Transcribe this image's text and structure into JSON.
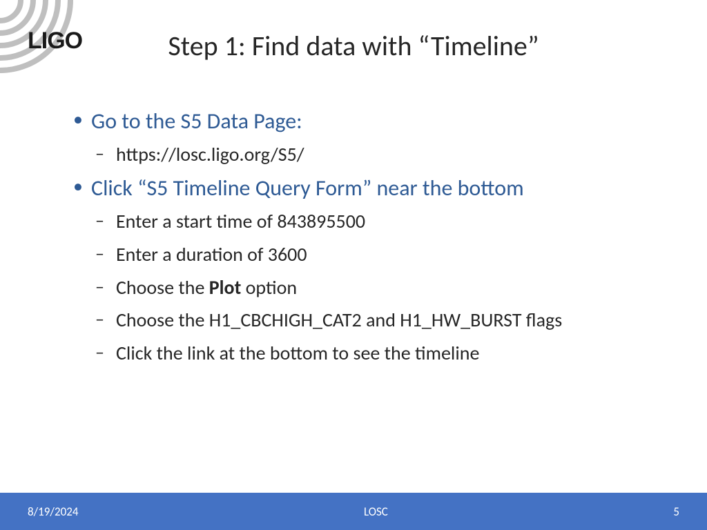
{
  "logo": {
    "text": "LIGO"
  },
  "title": "Step 1: Find data with “Timeline”",
  "bullets": [
    {
      "text": "Go to the S5 Data Page:",
      "children": [
        {
          "text": "https://losc.ligo.org/S5/"
        }
      ]
    },
    {
      "text": "Click “S5 Timeline Query Form” near the bottom",
      "children": [
        {
          "text": "Enter a start time of 843895500"
        },
        {
          "text": "Enter a duration of 3600"
        },
        {
          "before": "Choose the ",
          "bold": "Plot",
          "after": " option"
        },
        {
          "text": "Choose the H1_CBCHIGH_CAT2 and H1_HW_BURST flags"
        },
        {
          "text": "Click the link at the bottom to see the timeline"
        }
      ]
    }
  ],
  "footer": {
    "date": "8/19/2024",
    "center": "LOSC",
    "page": "5"
  }
}
